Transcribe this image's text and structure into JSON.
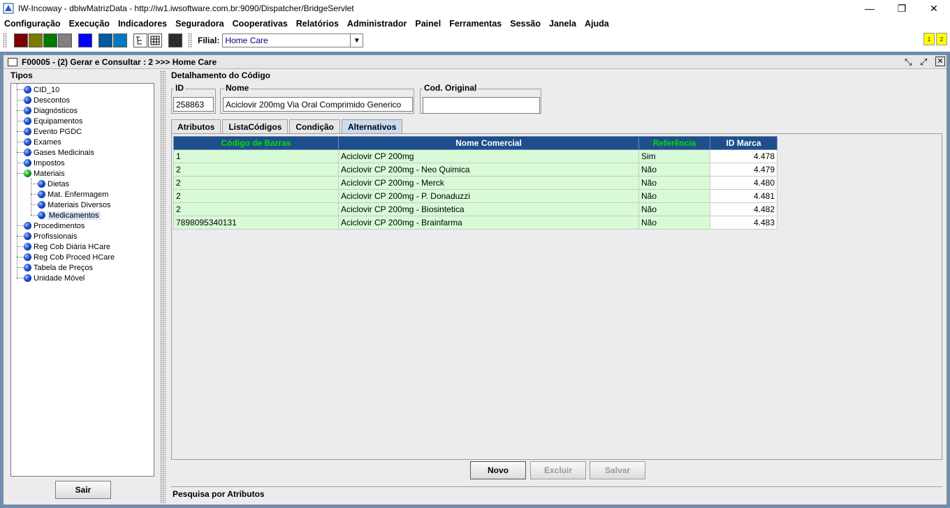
{
  "window": {
    "title": "IW-Incoway - dblwMatrizData - http://iw1.iwsoftware.com.br:9090/Dispatcher/BridgeServlet",
    "minimize": "—",
    "restore": "❐",
    "close": "✕"
  },
  "menu": [
    "Configuração",
    "Execução",
    "Indicadores",
    "Seguradora",
    "Cooperativas",
    "Relatórios",
    "Administrador",
    "Painel",
    "Ferramentas",
    "Sessão",
    "Janela",
    "Ajuda"
  ],
  "toolbar": {
    "filial_label": "Filial:",
    "filial_value": "Home Care",
    "yellow1": "1",
    "yellow2": "2",
    "colors": [
      "#7b0000",
      "#7b7b00",
      "#007b00",
      "#808080",
      "#0000ff",
      "#005b9f",
      "#007bbf",
      "#2b2b2b"
    ]
  },
  "frame": {
    "title": "F00005 - (2) Gerar e Consultar : 2 >>> Home Care"
  },
  "tree": {
    "group_label": "Tipos",
    "items": [
      {
        "label": "CID_10",
        "level": 0
      },
      {
        "label": "Descontos",
        "level": 0
      },
      {
        "label": "Diagnósticos",
        "level": 0
      },
      {
        "label": "Equipamentos",
        "level": 0
      },
      {
        "label": "Evento PGDC",
        "level": 0
      },
      {
        "label": "Exames",
        "level": 0
      },
      {
        "label": "Gases Medicinais",
        "level": 0
      },
      {
        "label": "Impostos",
        "level": 0
      },
      {
        "label": "Materiais",
        "level": 0
      },
      {
        "label": "Dietas",
        "level": 1
      },
      {
        "label": "Mat. Enfermagem",
        "level": 1
      },
      {
        "label": "Materiais Diversos",
        "level": 1
      },
      {
        "label": "Medicamentos",
        "level": 1
      },
      {
        "label": "Procedimentos",
        "level": 0
      },
      {
        "label": "Profissionais",
        "level": 0
      },
      {
        "label": "Reg Cob Diária HCare",
        "level": 0
      },
      {
        "label": "Reg Cob Proced HCare",
        "level": 0
      },
      {
        "label": "Tabela de Preços",
        "level": 0
      },
      {
        "label": "Unidade Móvel",
        "level": 0
      }
    ],
    "sair_label": "Sair"
  },
  "detail": {
    "group_label": "Detalhamento do Código",
    "id_label": "ID",
    "id_value": "258863",
    "nome_label": "Nome",
    "nome_value": "Aciclovir 200mg Via Oral Comprimido Generico",
    "cod_label": "Cod. Original",
    "cod_value": ""
  },
  "tabs": [
    "Atributos",
    "ListaCódigos",
    "Condição",
    "Alternativos"
  ],
  "table": {
    "headers": [
      "Código de Barras",
      "Nome Comercial",
      "Referência",
      "ID Marca"
    ],
    "rows": [
      [
        "1",
        "Aciclovir CP 200mg",
        "Sim",
        "4.478"
      ],
      [
        "2",
        "Aciclovir CP 200mg - Neo Quimica",
        "Não",
        "4.479"
      ],
      [
        "2",
        "Aciclovir CP 200mg - Merck",
        "Não",
        "4.480"
      ],
      [
        "2",
        "Aciclovir CP 200mg - P. Donaduzzi",
        "Não",
        "4.481"
      ],
      [
        "2",
        "Aciclovir CP 200mg - Biosintetica",
        "Não",
        "4.482"
      ],
      [
        "7898095340131",
        "Aciclovir CP 200mg - Brainfarma",
        "Não",
        "4.483"
      ]
    ]
  },
  "buttons": {
    "novo": "Novo",
    "excluir": "Excluir",
    "salvar": "Salvar"
  },
  "search_bar": "Pesquisa por Atributos"
}
